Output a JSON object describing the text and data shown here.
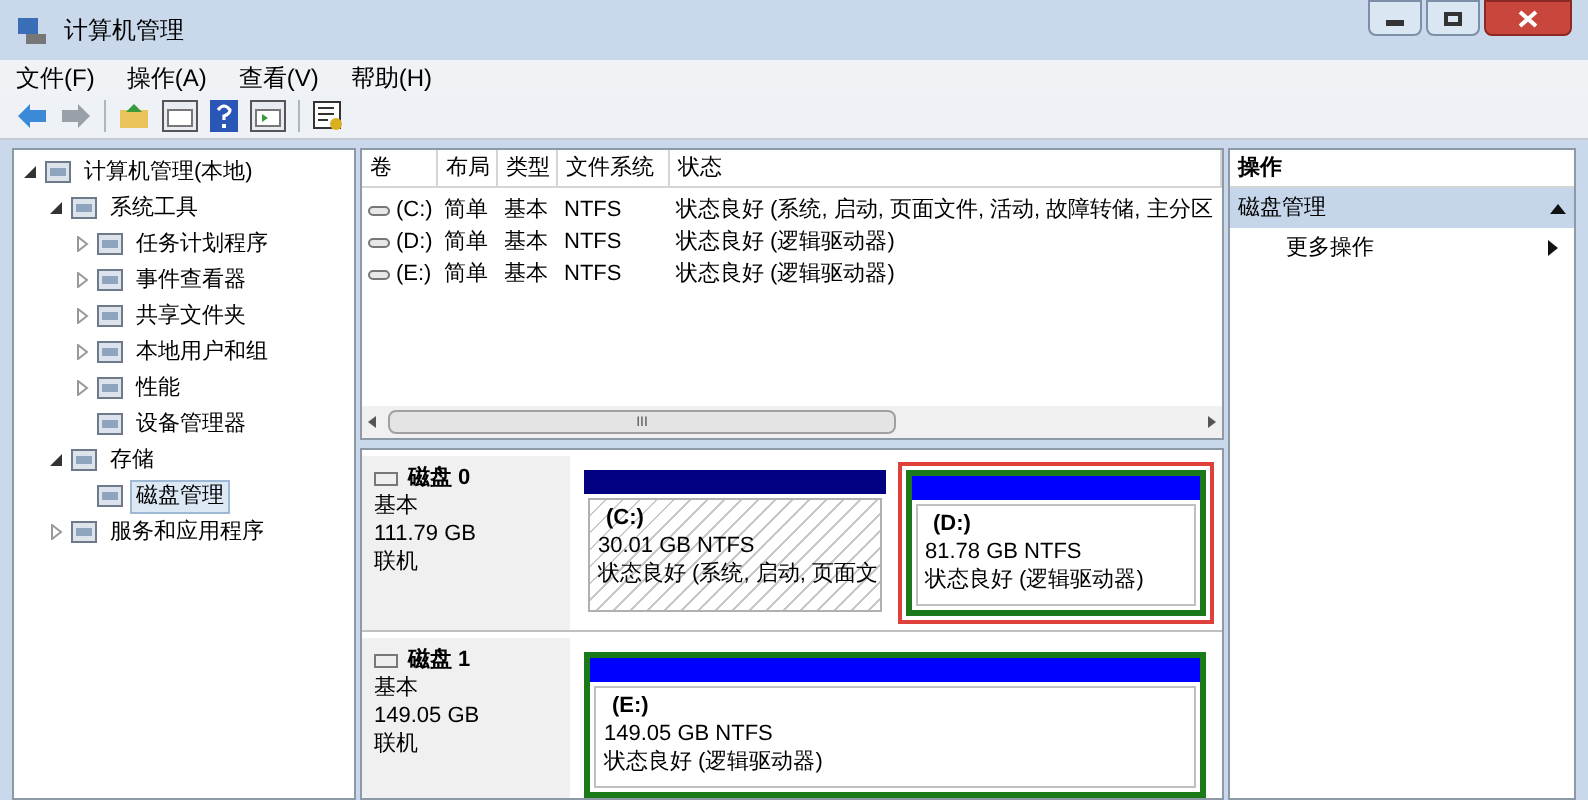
{
  "window": {
    "title": "计算机管理"
  },
  "menu": [
    "文件(F)",
    "操作(A)",
    "查看(V)",
    "帮助(H)"
  ],
  "tree": [
    {
      "label": "计算机管理(本地)",
      "expanded": true,
      "selected": false,
      "children": [
        {
          "label": "系统工具",
          "expanded": true,
          "selected": false,
          "children": [
            {
              "label": "任务计划程序",
              "expanded": false,
              "selected": false
            },
            {
              "label": "事件查看器",
              "expanded": false,
              "selected": false
            },
            {
              "label": "共享文件夹",
              "expanded": false,
              "selected": false
            },
            {
              "label": "本地用户和组",
              "expanded": false,
              "selected": false
            },
            {
              "label": "性能",
              "expanded": false,
              "selected": false
            },
            {
              "label": "设备管理器",
              "selected": false
            }
          ]
        },
        {
          "label": "存储",
          "expanded": true,
          "selected": false,
          "children": [
            {
              "label": "磁盘管理",
              "selected": true
            }
          ]
        },
        {
          "label": "服务和应用程序",
          "expanded": false,
          "selected": false
        }
      ]
    }
  ],
  "volumes": {
    "columns": [
      "卷",
      "布局",
      "类型",
      "文件系统",
      "状态"
    ],
    "rows": [
      [
        "(C:)",
        "简单",
        "基本",
        "NTFS",
        "状态良好 (系统, 启动, 页面文件, 活动, 故障转储, 主分区"
      ],
      [
        "(D:)",
        "简单",
        "基本",
        "NTFS",
        "状态良好 (逻辑驱动器)"
      ],
      [
        "(E:)",
        "简单",
        "基本",
        "NTFS",
        "状态良好 (逻辑驱动器)"
      ]
    ],
    "scrollbar_grip": "III"
  },
  "disks": [
    {
      "name": "磁盘 0",
      "type": "基本",
      "size": "111.79 GB",
      "status": "联机",
      "partitions": [
        {
          "kind": "primary",
          "label": "(C:)",
          "size": "30.01 GB NTFS",
          "status": "状态良好 (系统, 启动, 页面文",
          "highlighted": false
        },
        {
          "kind": "logical",
          "label": "(D:)",
          "size": "81.78 GB NTFS",
          "status": "状态良好 (逻辑驱动器)",
          "highlighted": true
        }
      ]
    },
    {
      "name": "磁盘 1",
      "type": "基本",
      "size": "149.05 GB",
      "status": "联机",
      "partitions": [
        {
          "kind": "logical",
          "label": "(E:)",
          "size": "149.05 GB NTFS",
          "status": "状态良好 (逻辑驱动器)",
          "highlighted": false
        }
      ]
    }
  ],
  "actions": {
    "title": "操作",
    "sections": [
      {
        "label": "磁盘管理",
        "expanded": true,
        "items": [
          "更多操作"
        ]
      }
    ]
  }
}
